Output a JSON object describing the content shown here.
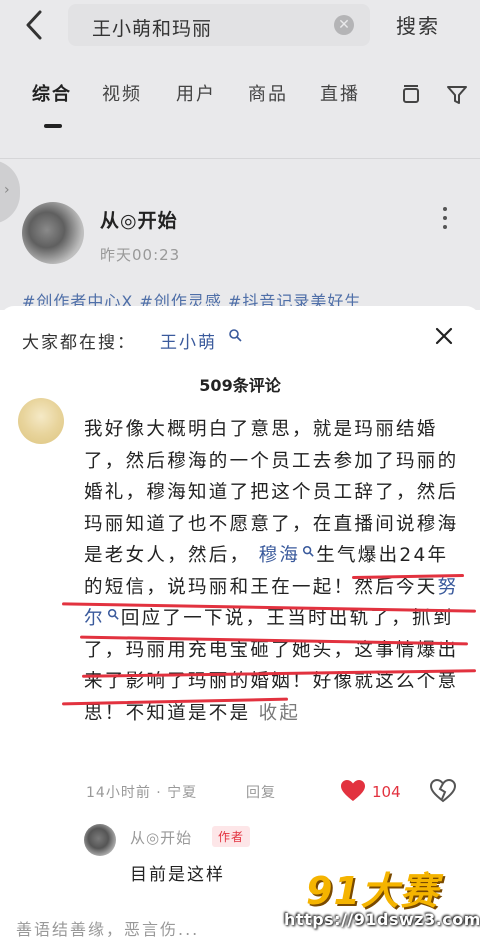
{
  "search": {
    "query": "王小萌和玛丽",
    "submit_label": "搜索"
  },
  "tabs": [
    {
      "label": "综合",
      "active": true
    },
    {
      "label": "视频"
    },
    {
      "label": "用户"
    },
    {
      "label": "商品"
    },
    {
      "label": "直播"
    }
  ],
  "post": {
    "author": "从◎开始",
    "time": "昨天00:23",
    "tags": "#创作者中心X #创作灵感 #抖音记录美好生"
  },
  "trending": {
    "label": "大家都在搜：",
    "keyword": "王小萌"
  },
  "comments_header": {
    "count": "509条评论"
  },
  "comment": {
    "text_1": "我好像大概明白了意思，就是玛丽结婚了，然后穆海的一个员工去参加了玛丽的婚礼，穆海知道了把这个员工辞了，然后玛丽知道了也不愿意了，在直播间说穆海是老女人，然后，",
    "kw_1": "穆海",
    "text_2": "生气爆出24年的短信，说玛丽和王在一起！然后今天",
    "kw_2": "努尔",
    "text_3": "回应了一下说，王当时出轨了，抓到了，玛丽用充电宝砸了她头，这事情爆出来了影响了玛丽的婚姻！好像就这么个意思！不知道是不是",
    "fold_label": "收起",
    "meta": "14小时前 · 宁夏",
    "reply_label": "回复",
    "likes": "104"
  },
  "reply": {
    "author": "从◎开始",
    "badge": "作者",
    "text": "目前是这样"
  },
  "input": {
    "placeholder": "善语结善缘，恶言伤..."
  },
  "watermark": {
    "logo": "91大赛",
    "url": "https://91dswz3.com"
  },
  "colors": {
    "link": "#3a5a9c",
    "accent_red": "#e2323f"
  }
}
